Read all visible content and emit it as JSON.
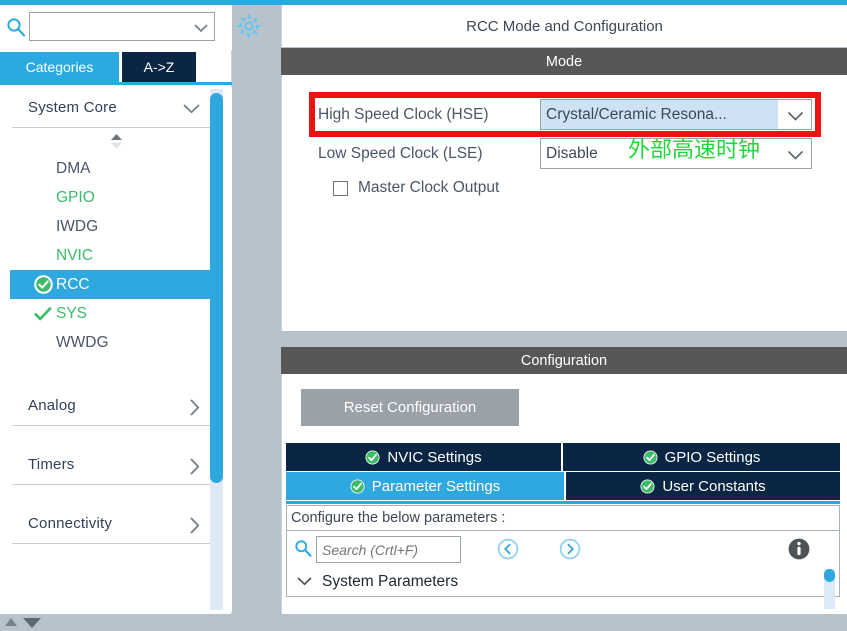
{
  "sidebar": {
    "search": {
      "value": "",
      "placeholder": "",
      "icon": "search-icon"
    },
    "gear_icon": "gear-icon",
    "tabs": [
      {
        "label": "Categories",
        "active": true
      },
      {
        "label": "A->Z",
        "active": false
      }
    ],
    "groups": [
      {
        "label": "System Core",
        "expanded": true,
        "items": [
          {
            "label": "DMA",
            "state": "none",
            "color": "#4a5666"
          },
          {
            "label": "GPIO",
            "state": "none",
            "color": "#3dbb6a"
          },
          {
            "label": "IWDG",
            "state": "none",
            "color": "#4a5666"
          },
          {
            "label": "NVIC",
            "state": "none",
            "color": "#3dbb6a"
          },
          {
            "label": "RCC",
            "state": "configured",
            "color": "#ffffff",
            "selected": true
          },
          {
            "label": "SYS",
            "state": "check",
            "color": "#3dbb6a"
          },
          {
            "label": "WWDG",
            "state": "none",
            "color": "#4a5666"
          }
        ]
      },
      {
        "label": "Analog",
        "expanded": false,
        "items": []
      },
      {
        "label": "Timers",
        "expanded": false,
        "items": []
      },
      {
        "label": "Connectivity",
        "expanded": false,
        "items": []
      }
    ]
  },
  "main": {
    "title": "RCC Mode and Configuration",
    "mode": {
      "header": "Mode",
      "hse": {
        "label": "High Speed Clock (HSE)",
        "value": "Crystal/Ceramic Resona...",
        "highlighted": true
      },
      "lse": {
        "label": "Low Speed Clock (LSE)",
        "value": "Disable"
      },
      "master_clock_output": {
        "label": "Master Clock Output",
        "checked": false
      }
    },
    "configuration": {
      "header": "Configuration",
      "reset_button": "Reset Configuration",
      "tabs": [
        {
          "label": "NVIC Settings",
          "active": false,
          "check": true
        },
        {
          "label": "GPIO Settings",
          "active": false,
          "check": true
        },
        {
          "label": "Parameter Settings",
          "active": true,
          "check": true
        },
        {
          "label": "User Constants",
          "active": false,
          "check": true
        }
      ],
      "hint": "Configure the below parameters :",
      "search": {
        "value": "",
        "placeholder": "Search (Crtl+F)"
      },
      "nav_prev_icon": "circle-left-arrow-icon",
      "nav_next_icon": "circle-right-arrow-icon",
      "info_icon": "info-icon",
      "tree": [
        {
          "label": "System Parameters",
          "expanded": true
        }
      ]
    }
  },
  "annotations": {
    "red_box_color": "#ee1111",
    "green_text": "外部高速时钟",
    "green_text_color": "#21d83a"
  },
  "colors": {
    "accent_blue": "#29abe2",
    "tab_navy": "#0b2545",
    "section_gray": "#575757",
    "window_bg": "#b6c2cc",
    "green_check": "#3dbb6a"
  }
}
